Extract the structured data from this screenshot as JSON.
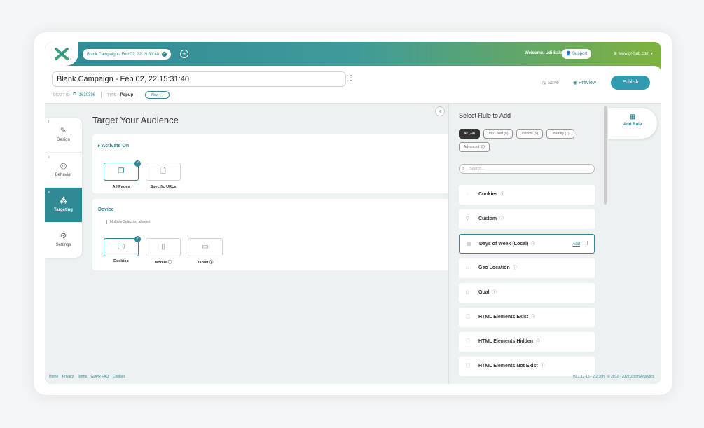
{
  "topbar": {
    "tab_label": "Blank Campaign - Feb 02, 22 15:31:40",
    "welcome": "Welcome,",
    "user": "Udi Salant",
    "support": "Support",
    "site": "www.gr-hub.com"
  },
  "header": {
    "campaign_name": "Blank Campaign - Feb 02, 22 15:31:40",
    "draft_label": "DRAFT ID:",
    "draft_id": "1630396",
    "type_label": "TYPE:",
    "type_value": "Popup",
    "status": "New",
    "save": "Save",
    "preview": "Preview",
    "publish": "Publish"
  },
  "steps": [
    {
      "num": "1",
      "label": "Design"
    },
    {
      "num": "2",
      "label": "Behavior"
    },
    {
      "num": "3",
      "label": "Targeting"
    },
    {
      "num": "",
      "label": "Settings"
    }
  ],
  "main": {
    "title": "Target Your Audience",
    "activate_on": "Activate On",
    "all_pages": "All Pages",
    "specific_urls": "Specific URLs",
    "device": "Device",
    "device_hint": "Multiple Selection allowed",
    "desktop": "Desktop",
    "mobile": "Mobile",
    "tablet": "Tablet"
  },
  "panel": {
    "title": "Select Rule to Add",
    "filters": [
      "All (24)",
      "Top Used (6)",
      "Visitors (9)",
      "Journey (7)",
      "Advanced (8)"
    ],
    "search_placeholder": "Search...",
    "rules": [
      "Cookies",
      "Custom",
      "Days of Week (Local)",
      "Geo Location",
      "Goal",
      "HTML Elements Exist",
      "HTML Elements Hidden",
      "HTML Elements Not Exist"
    ],
    "add": "Add"
  },
  "add_rule": "Add Rule",
  "footer": {
    "links": [
      "Home",
      "Privacy",
      "Terms",
      "GDPR FAQ",
      "Cookies"
    ],
    "version": "v0.1.12-15 - 2.2.36h",
    "copyright": "© 2012 - 2022 Zoom Analytics"
  },
  "colors": {
    "accent": "#2f8a96",
    "publish": "#2f9ab0",
    "gradient_end": "#7fb23f"
  }
}
